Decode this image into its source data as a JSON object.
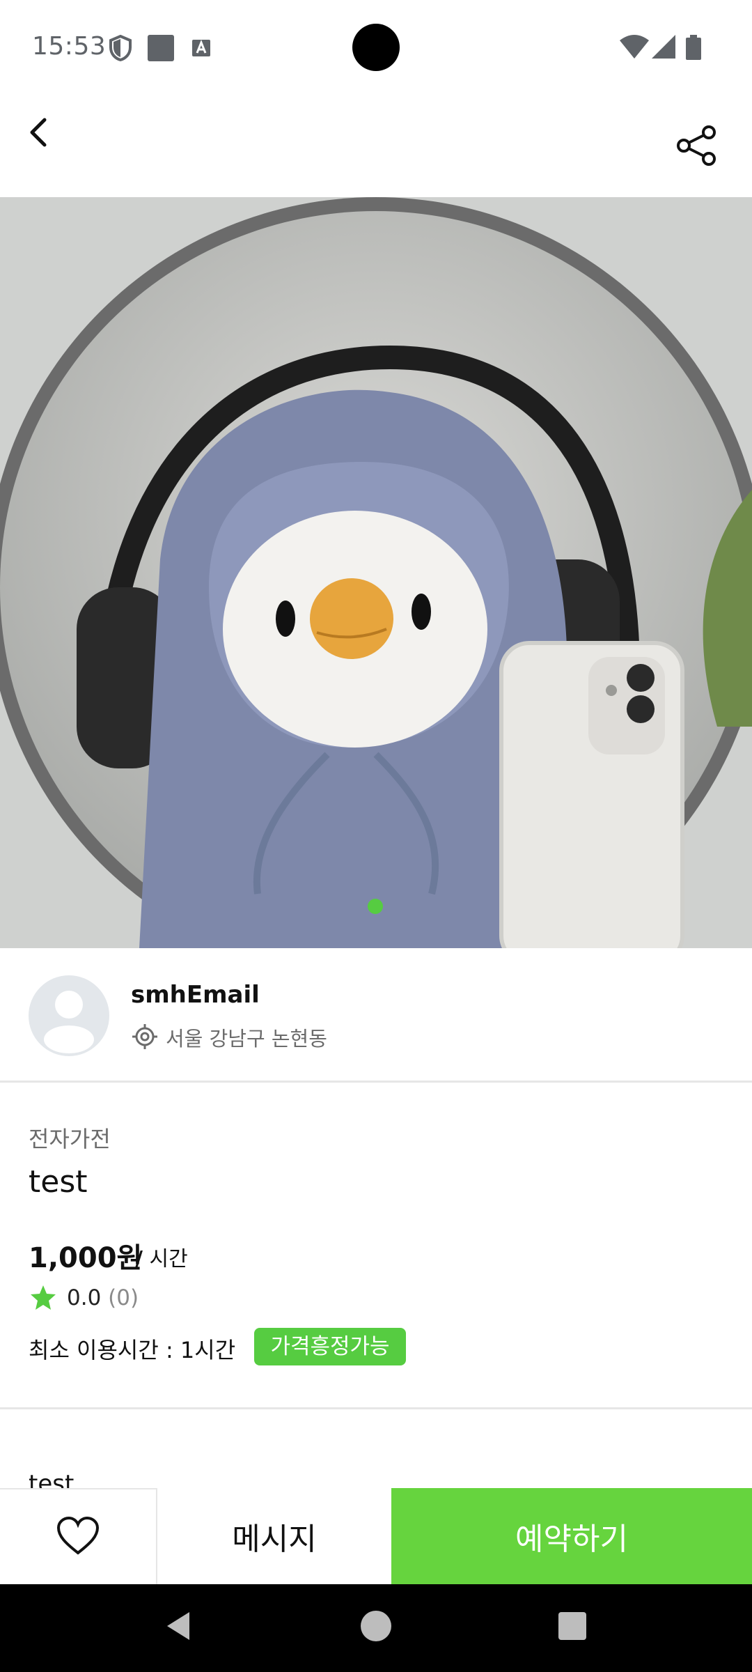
{
  "status_bar": {
    "time": "15:53"
  },
  "seller": {
    "name": "smhEmail",
    "location": "서울 강남구 논현동"
  },
  "item": {
    "category": "전자가전",
    "title": "test",
    "price": "1,000원",
    "price_unit_slash": "/",
    "price_unit": "시간",
    "rating": "0.0",
    "rating_count": "(0)",
    "min_time": "최소 이용시간 : 1시간",
    "negotiable_badge": "가격흥정가능",
    "description": "test"
  },
  "bottom": {
    "message_label": "메시지",
    "book_label": "예약하기"
  },
  "colors": {
    "accent": "#66d43e",
    "badge": "#56cc41",
    "dot": "#56cc41"
  },
  "icons": [
    "back-arrow-icon",
    "share-icon",
    "location-icon",
    "star-icon",
    "heart-icon",
    "shield-icon",
    "wifi-icon",
    "signal-icon",
    "battery-icon"
  ]
}
